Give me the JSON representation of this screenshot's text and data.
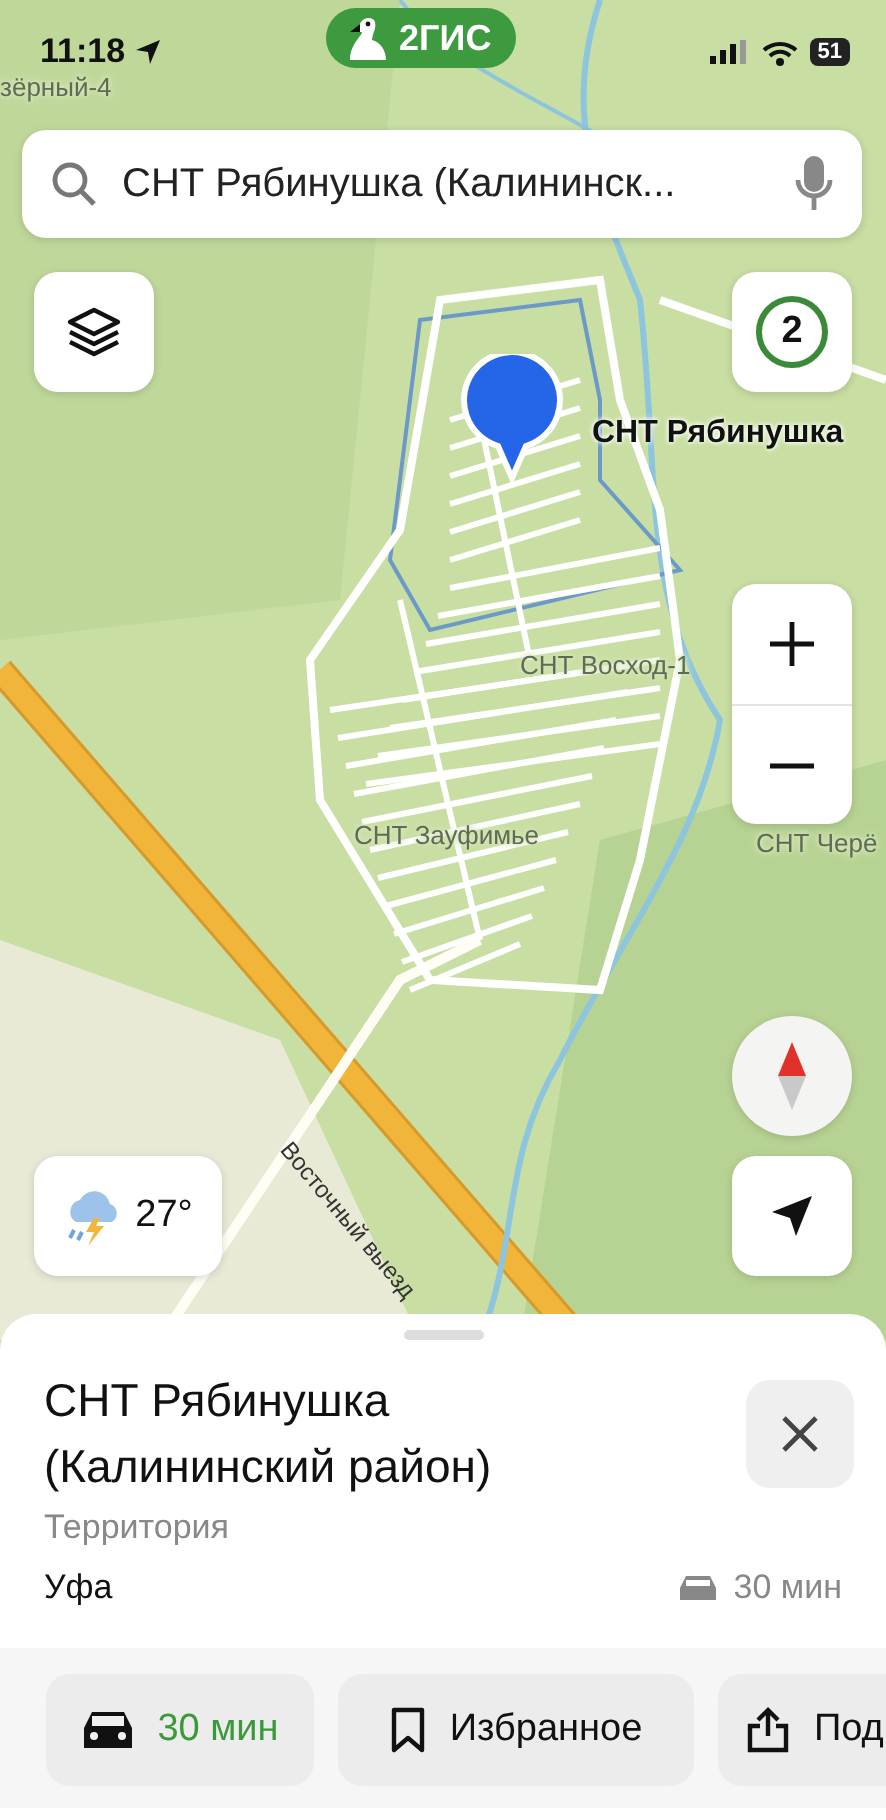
{
  "status_bar": {
    "time": "11:18",
    "battery": "51"
  },
  "logo": {
    "text": "2ГИС"
  },
  "search": {
    "value": "СНТ Рябинушка (Калининск..."
  },
  "map": {
    "labels": [
      {
        "kind": "area",
        "text": "зёрный-4"
      },
      {
        "kind": "place",
        "text": "СНТ Рябинушка"
      },
      {
        "kind": "area",
        "text": "СНТ Восход-1"
      },
      {
        "kind": "area",
        "text": "СНТ Зауфимье"
      },
      {
        "kind": "area",
        "text": "СНТ Черё"
      },
      {
        "kind": "road",
        "text": "Восточный выезд"
      }
    ]
  },
  "counter": "2",
  "weather": {
    "temperature": "27°"
  },
  "sheet": {
    "title": "СНТ Рябинушка (Калининский район)",
    "category": "Территория",
    "city": "Уфа",
    "travel_time": "30 мин"
  },
  "actions": [
    {
      "kind": "route",
      "label": "30 мин"
    },
    {
      "kind": "favorite",
      "label": "Избранное"
    },
    {
      "kind": "share",
      "label": "Под"
    }
  ]
}
